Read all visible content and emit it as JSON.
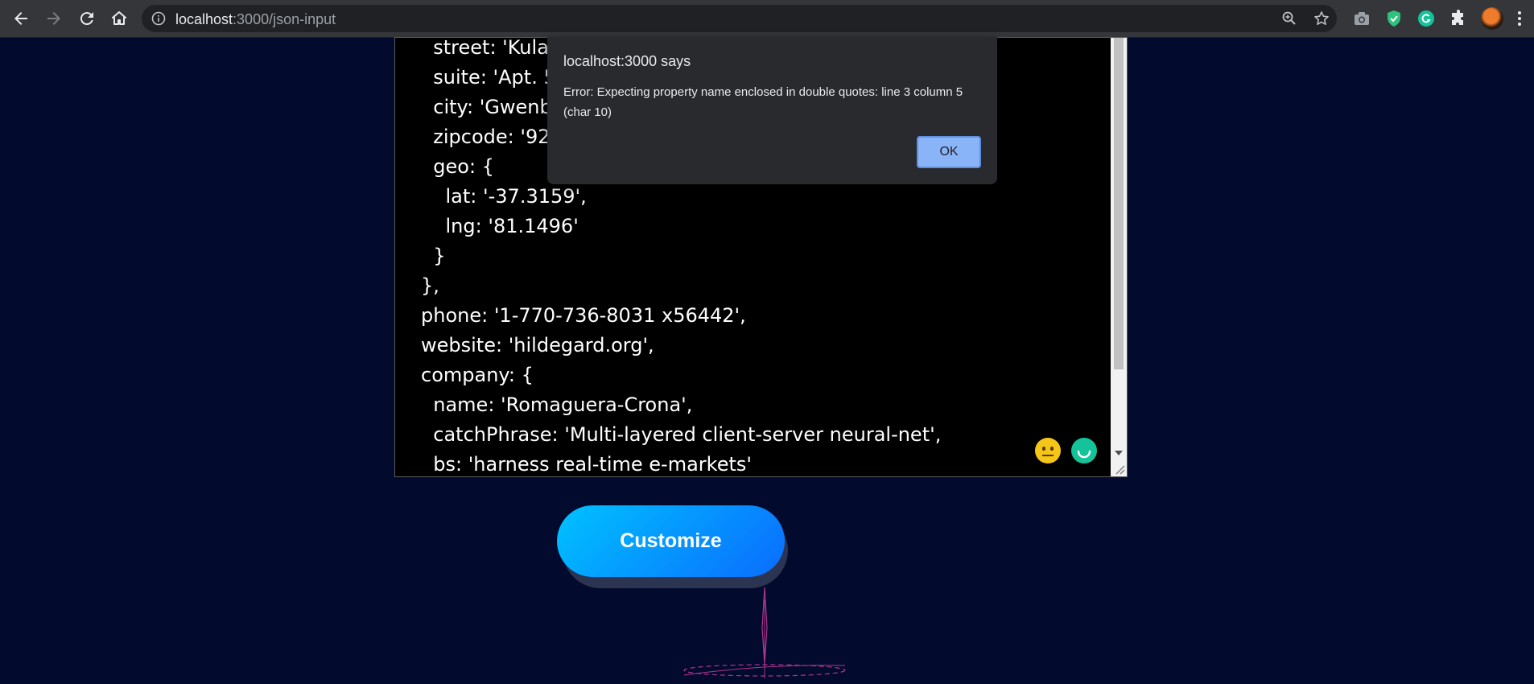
{
  "browser": {
    "url_host": "localhost",
    "url_path": ":3000/json-input",
    "icons": [
      "back-icon",
      "forward-icon",
      "reload-icon",
      "home-icon",
      "site-info-icon",
      "zoom-icon",
      "bookmark-star-icon",
      "camera-icon",
      "shield-check-icon",
      "grammarly-icon",
      "extensions-puzzle-icon",
      "profile-avatar",
      "menu-dots-icon"
    ]
  },
  "editor": {
    "lines": [
      "  street: 'Kulas Light',",
      "  suite: 'Apt. 556',",
      "  city: 'Gwenborough',",
      "  zipcode: '92998-3874',",
      "  geo: {",
      "    lat: '-37.3159',",
      "    lng: '81.1496'",
      "  }",
      "},",
      "phone: '1-770-736-8031 x56442',",
      "website: 'hildegard.org',",
      "company: {",
      "  name: 'Romaguera-Crona',",
      "  catchPhrase: 'Multi-layered client-server neural-net',",
      "  bs: 'harness real-time e-markets'"
    ]
  },
  "alert": {
    "title": "localhost:3000 says",
    "message": "Error: Expecting property name enclosed in double quotes: line 3 column 5 (char 10)",
    "ok_label": "OK"
  },
  "actions": {
    "customize_label": "Customize"
  },
  "colors": {
    "page_bg": "#020a2e",
    "button_gradient_start": "#00c2ff",
    "button_gradient_end": "#0a6cff",
    "alert_ok": "#8ab4f8"
  }
}
